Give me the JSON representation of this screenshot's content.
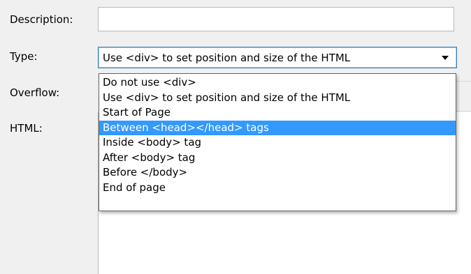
{
  "form": {
    "description_label": "Description:",
    "description_value": "",
    "type_label": "Type:",
    "type_value": "Use <div> to set position and size of the HTML",
    "overflow_label": "Overflow:",
    "html_label": "HTML:"
  },
  "dropdown": {
    "options": [
      "Do not use <div>",
      "Use <div> to set position and size of the HTML",
      "Start of Page",
      "Between <head></head> tags",
      "Inside <body> tag",
      "After <body> tag",
      "Before </body>",
      "End of page"
    ],
    "highlighted_option": "Between <head></head> tags"
  },
  "colors": {
    "highlight": "#3399ff",
    "highlight_text": "#ffffff",
    "focus_border": "#3c7fb1",
    "background": "#f0f0f0"
  },
  "icons": {
    "type_select_arrow": "chevron-down-icon"
  }
}
